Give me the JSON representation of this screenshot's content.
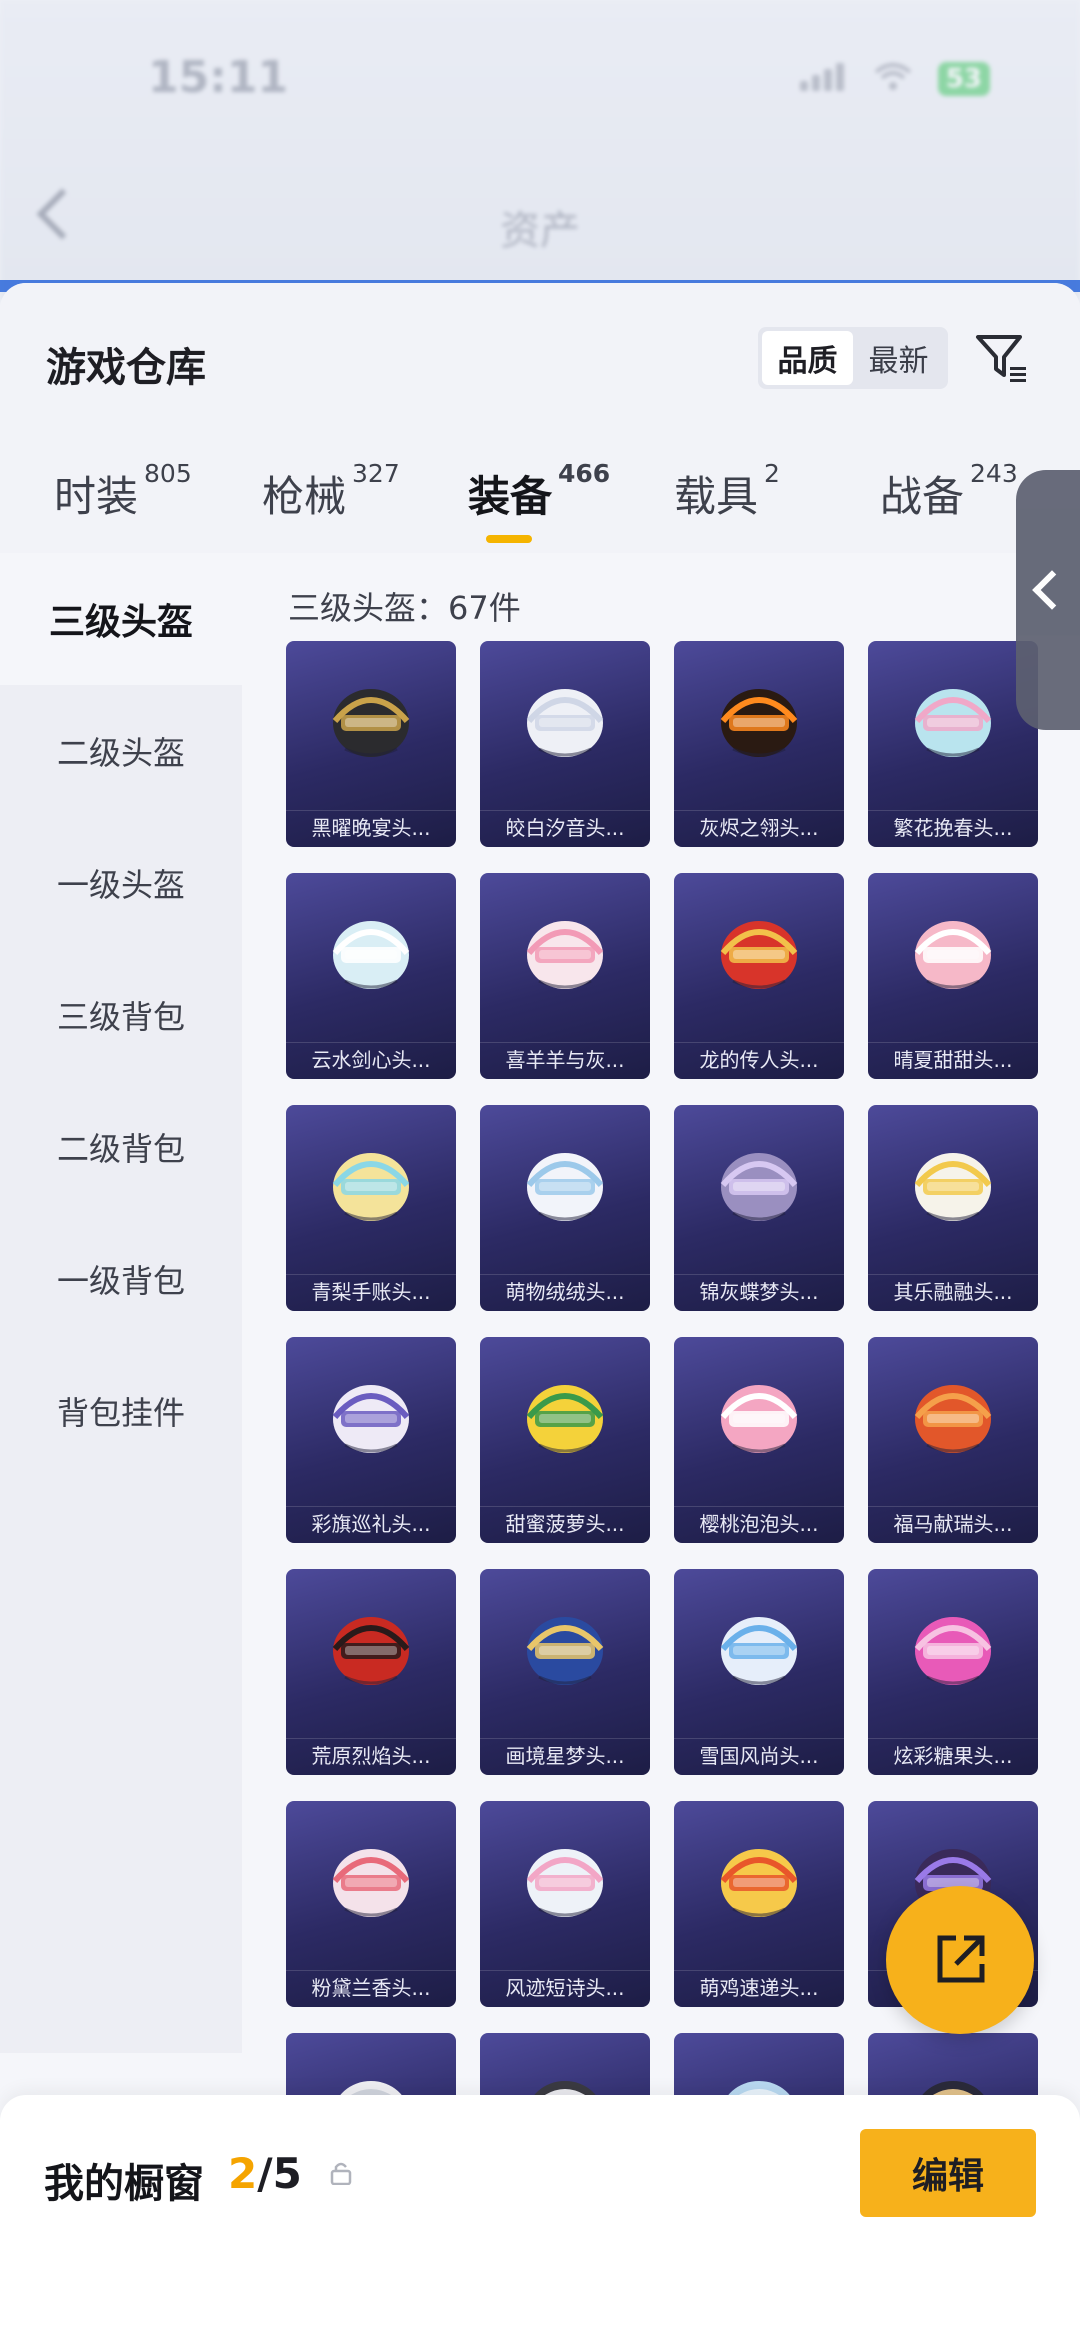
{
  "status": {
    "time": "15:11",
    "battery": "53"
  },
  "background": {
    "title": "资产"
  },
  "sheet": {
    "title": "游戏仓库",
    "sort_options": [
      "品质",
      "最新"
    ],
    "active_sort": "品质"
  },
  "tabs": [
    {
      "label": "时装",
      "count": "805"
    },
    {
      "label": "枪械",
      "count": "327"
    },
    {
      "label": "装备",
      "count": "466",
      "active": true
    },
    {
      "label": "载具",
      "count": "2"
    },
    {
      "label": "战备",
      "count": "243"
    }
  ],
  "categories": [
    {
      "label": "三级头盔",
      "active": true
    },
    {
      "label": "二级头盔"
    },
    {
      "label": "一级头盔"
    },
    {
      "label": "三级背包"
    },
    {
      "label": "二级背包"
    },
    {
      "label": "一级背包"
    },
    {
      "label": "背包挂件"
    }
  ],
  "section": {
    "label": "三级头盔：67件"
  },
  "items": [
    {
      "name": "黑曜晚宴头...",
      "color": "#2b2b2e",
      "accent": "#c9a24a"
    },
    {
      "name": "皎白汐音头...",
      "color": "#eef0f6",
      "accent": "#cfd6e6"
    },
    {
      "name": "灰烬之翎头...",
      "color": "#2a1a12",
      "accent": "#ff8a1e"
    },
    {
      "name": "繁花挽春头...",
      "color": "#b9e4ee",
      "accent": "#f0a8c8"
    },
    {
      "name": "云水剑心头...",
      "color": "#d9eef5",
      "accent": "#ffffff"
    },
    {
      "name": "喜羊羊与灰...",
      "color": "#f8e6ec",
      "accent": "#f29ab6"
    },
    {
      "name": "龙的传人头...",
      "color": "#d8342a",
      "accent": "#f2c14a"
    },
    {
      "name": "晴夏甜甜头...",
      "color": "#f6b8c8",
      "accent": "#ffffff"
    },
    {
      "name": "青梨手账头...",
      "color": "#f4e39a",
      "accent": "#8ad7e6"
    },
    {
      "name": "萌物绒绒头...",
      "color": "#f2f4fa",
      "accent": "#9cc9ea"
    },
    {
      "name": "锦灰蝶梦头...",
      "color": "#9a8fc0",
      "accent": "#d7c8f2"
    },
    {
      "name": "其乐融融头...",
      "color": "#f6f3ea",
      "accent": "#f2c94c"
    },
    {
      "name": "彩旗巡礼头...",
      "color": "#eeeaf6",
      "accent": "#6a5cc0"
    },
    {
      "name": "甜蜜菠萝头...",
      "color": "#f4d23a",
      "accent": "#3a9a4a"
    },
    {
      "name": "樱桃泡泡头...",
      "color": "#f4a6c2",
      "accent": "#ffffff"
    },
    {
      "name": "福马献瑞头...",
      "color": "#e2572a",
      "accent": "#f5a04a"
    },
    {
      "name": "荒原烈焰头...",
      "color": "#c92a22",
      "accent": "#2a1a1a"
    },
    {
      "name": "画境星梦头...",
      "color": "#2a4aa0",
      "accent": "#e8c66a"
    },
    {
      "name": "雪国风尚头...",
      "color": "#e6eefa",
      "accent": "#6ab0ea"
    },
    {
      "name": "炫彩糖果头...",
      "color": "#e85ab8",
      "accent": "#f7c2e2"
    },
    {
      "name": "粉黛兰香头...",
      "color": "#f4e2ea",
      "accent": "#e86a7a"
    },
    {
      "name": "风迹短诗头...",
      "color": "#eef2f8",
      "accent": "#f2a6c6"
    },
    {
      "name": "萌鸡速递头...",
      "color": "#f6c94a",
      "accent": "#e8562a"
    },
    {
      "name": "",
      "color": "#3a2a5a",
      "accent": "#9a7ae8"
    },
    {
      "name": "",
      "color": "#eeeef2",
      "accent": "#cfd3dc"
    },
    {
      "name": "",
      "color": "#3a3a42",
      "accent": "#e9e9ee"
    },
    {
      "name": "",
      "color": "#b8d8f0",
      "accent": "#e8f2fa"
    },
    {
      "name": "",
      "color": "#2a2a3a",
      "accent": "#e0c08a"
    }
  ],
  "showcase": {
    "title": "我的橱窗",
    "current": "2",
    "total": "/5",
    "edit_label": "编辑"
  }
}
